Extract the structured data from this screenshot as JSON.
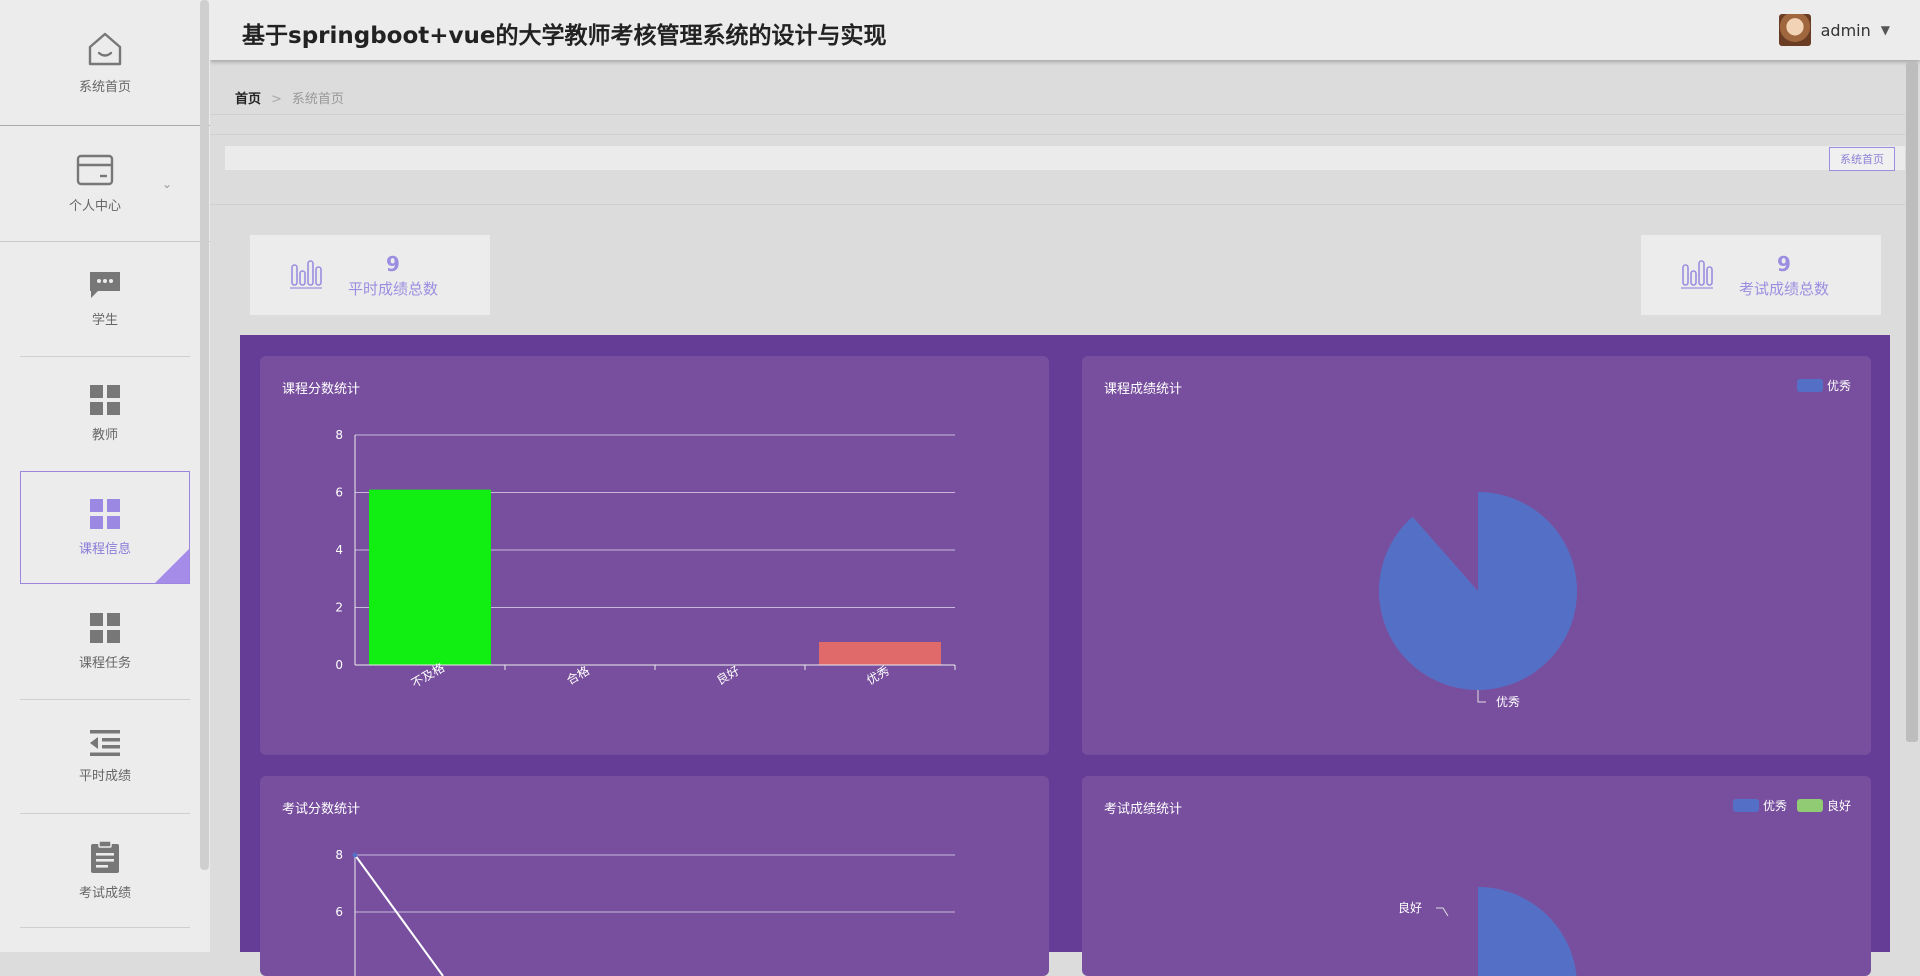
{
  "header": {
    "title": "基于springboot+vue的大学教师考核管理系统的设计与实现",
    "user_name": "admin"
  },
  "sidebar": {
    "items": [
      {
        "label": "系统首页",
        "icon": "home-icon"
      },
      {
        "label": "个人中心",
        "icon": "card-icon"
      },
      {
        "label": "学生",
        "icon": "chat-icon"
      },
      {
        "label": "教师",
        "icon": "grid-icon"
      },
      {
        "label": "课程信息",
        "icon": "grid-icon"
      },
      {
        "label": "课程任务",
        "icon": "grid-icon"
      },
      {
        "label": "平时成绩",
        "icon": "list-indent-icon"
      },
      {
        "label": "考试成绩",
        "icon": "clipboard-icon"
      }
    ]
  },
  "breadcrumb": {
    "home": "首页",
    "separator": ">",
    "current": "系统首页"
  },
  "tab_strip": {
    "button_label": "系统首页"
  },
  "stats": [
    {
      "value": "9",
      "label": "平时成绩总数"
    },
    {
      "value": "9",
      "label": "考试成绩总数"
    }
  ],
  "colors": {
    "accent": "#9b8ee0",
    "dashboard_bg": "#653d96",
    "panel_bg": "#784f9e",
    "bar_pass_fail": "#11ee11",
    "bar_excellent": "#e06a6a",
    "pie_blue": "#5470c6",
    "pie_green": "#91cc75"
  },
  "panels": {
    "course_score": {
      "title": "课程分数统计"
    },
    "course_grade": {
      "title": "课程成绩统计"
    },
    "exam_score": {
      "title": "考试分数统计"
    },
    "exam_grade": {
      "title": "考试成绩统计"
    }
  },
  "chart_data": [
    {
      "type": "bar",
      "title": "课程分数统计",
      "categories": [
        "不及格",
        "合格",
        "良好",
        "优秀"
      ],
      "values": [
        6.1,
        0,
        0,
        0.8
      ],
      "ylim": [
        0,
        8
      ],
      "yticks": [
        0,
        2,
        4,
        6,
        8
      ],
      "grid": true
    },
    {
      "type": "pie",
      "title": "课程成绩统计",
      "labels": [
        "优秀"
      ],
      "values": [
        1
      ],
      "legend": [
        "优秀"
      ],
      "legend_position": "top-right"
    },
    {
      "type": "line",
      "title": "考试分数统计",
      "ylim": [
        0,
        8
      ],
      "yticks": [
        6,
        8
      ],
      "points": [
        8
      ],
      "grid": true
    },
    {
      "type": "pie",
      "title": "考试成绩统计",
      "labels": [
        "良好"
      ],
      "legend": [
        "优秀",
        "良好"
      ],
      "legend_position": "top-right"
    }
  ]
}
